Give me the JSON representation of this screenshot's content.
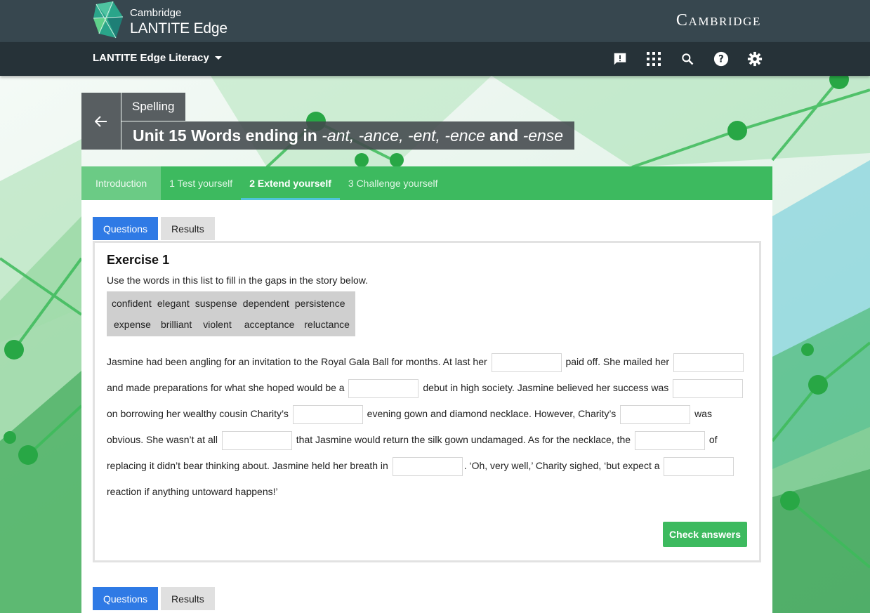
{
  "header": {
    "logo_line1": "Cambridge",
    "logo_line2": "LANTITE Edge",
    "brand_wordmark": "Cambridge"
  },
  "navbar": {
    "product_title": "LANTITE Edge Literacy",
    "icons": [
      "feedback-icon",
      "apps-grid-icon",
      "search-icon",
      "help-icon",
      "settings-icon"
    ]
  },
  "heading": {
    "breadcrumb": "Spelling",
    "title_prefix": "Unit 15 Words ending in ",
    "title_suffix_1": "-ant, -ance, -ent, -ence",
    "title_and": " and ",
    "title_suffix_2": "-ense"
  },
  "section_tabs": [
    {
      "label": "Introduction"
    },
    {
      "label": "1 Test yourself"
    },
    {
      "label": "2 Extend yourself"
    },
    {
      "label": "3 Challenge yourself"
    }
  ],
  "active_section_tab": "2 Extend yourself",
  "sub_tabs": {
    "questions": "Questions",
    "results": "Results"
  },
  "exercise": {
    "title": "Exercise 1",
    "instruction": "Use the words in this list to fill in the gaps in the story below.",
    "word_bank_row1": [
      "confident",
      "elegant",
      "suspense",
      "dependent",
      "persistence"
    ],
    "word_bank_row2": [
      "expense",
      "brilliant",
      "violent",
      "acceptance",
      "reluctance"
    ],
    "story": {
      "s1": "Jasmine had been angling for an invitation to the Royal Gala Ball for months. At last her",
      "s2": "paid off. She mailed her",
      "s3": "and made preparations for what she hoped would be a",
      "s4": "debut in high society. Jasmine believed her success was",
      "s5": "on borrowing her wealthy cousin Charity’s",
      "s6": "evening gown and diamond necklace. However, Charity’s",
      "s7": "was obvious. She wasn’t at all",
      "s8": "that Jasmine would return the silk gown undamaged. As for the necklace, the",
      "s9": "of replacing it didn’t bear thinking about. Jasmine held her breath in",
      "s10": ". ‘Oh, very well,’ Charity sighed, ‘but expect a",
      "s11": "reaction if anything untoward happens!’"
    },
    "check_button": "Check answers"
  },
  "colors": {
    "topbar": "#37474f",
    "navbar": "#263238",
    "section_green": "#3dba5f",
    "tab_blue": "#2f7ae5",
    "active_underline": "#4fc3d9"
  }
}
